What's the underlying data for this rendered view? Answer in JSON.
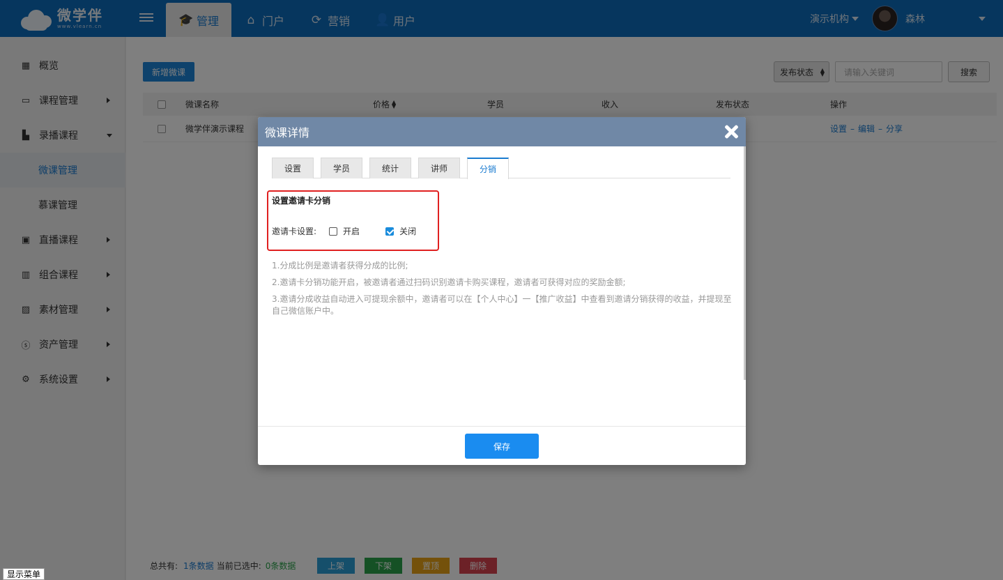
{
  "topbar": {
    "logo_cn": "微学伴",
    "logo_en": "www.vlearn.cn",
    "nav": [
      {
        "label": "管理",
        "icon": "graduation-cap-icon",
        "active": true
      },
      {
        "label": "门户",
        "icon": "home-icon",
        "active": false
      },
      {
        "label": "营销",
        "icon": "refresh-icon",
        "active": false
      },
      {
        "label": "用户",
        "icon": "user-gear-icon",
        "active": false
      }
    ],
    "org": "演示机构",
    "username": "森林"
  },
  "sidebar": {
    "items": [
      {
        "label": "概览",
        "icon": "grid-icon"
      },
      {
        "label": "课程管理",
        "icon": "book-icon"
      },
      {
        "label": "录播课程",
        "icon": "building-icon"
      },
      {
        "label": "微课管理",
        "sub": true,
        "active": true
      },
      {
        "label": "慕课管理",
        "sub": true
      },
      {
        "label": "直播课程",
        "icon": "presentation-icon"
      },
      {
        "label": "组合课程",
        "icon": "bar-chart-icon"
      },
      {
        "label": "素材管理",
        "icon": "image-icon"
      },
      {
        "label": "资产管理",
        "icon": "dollar-circle-icon"
      },
      {
        "label": "系统设置",
        "icon": "gear-icon"
      }
    ]
  },
  "toolbar": {
    "add_label": "新增微课",
    "filter_label": "发布状态",
    "search_placeholder": "请输入关键词",
    "search_label": "搜索"
  },
  "table": {
    "headers": [
      "微课名称",
      "价格",
      "学员",
      "收入",
      "发布状态",
      "操作"
    ],
    "rows": [
      {
        "name": "微学伴演示课程",
        "ops": [
          "设置",
          "编辑",
          "分享"
        ],
        "sep": "–"
      }
    ]
  },
  "footer": {
    "total_label": "总共有:",
    "total_value": "1条数据",
    "selected_label": "当前已选中:",
    "selected_value": "0条数据",
    "buttons": [
      {
        "label": "上架",
        "color": "#2a9fd6"
      },
      {
        "label": "下架",
        "color": "#2aa24a"
      },
      {
        "label": "置顶",
        "color": "#e8a317"
      },
      {
        "label": "删除",
        "color": "#d9434e"
      }
    ],
    "show_menu": "显示菜单"
  },
  "modal": {
    "title": "微课详情",
    "tabs": [
      "设置",
      "学员",
      "统计",
      "讲师",
      "分销"
    ],
    "active_tab": 4,
    "section_title": "设置邀请卡分销",
    "setting_label": "邀请卡设置:",
    "option_on": "开启",
    "option_off": "关闭",
    "selected_option": "关闭",
    "notes": [
      "1.分成比例是邀请者获得分成的比例;",
      "2.邀请卡分销功能开启，被邀请者通过扫码识别邀请卡购买课程，邀请者可获得对应的奖励金额;",
      "3.邀请分成收益自动进入可提现余额中，邀请者可以在【个人中心】一【推广收益】中查看到邀请分销获得的收益，并提现至自己微信账户中。"
    ],
    "save_label": "保存"
  }
}
